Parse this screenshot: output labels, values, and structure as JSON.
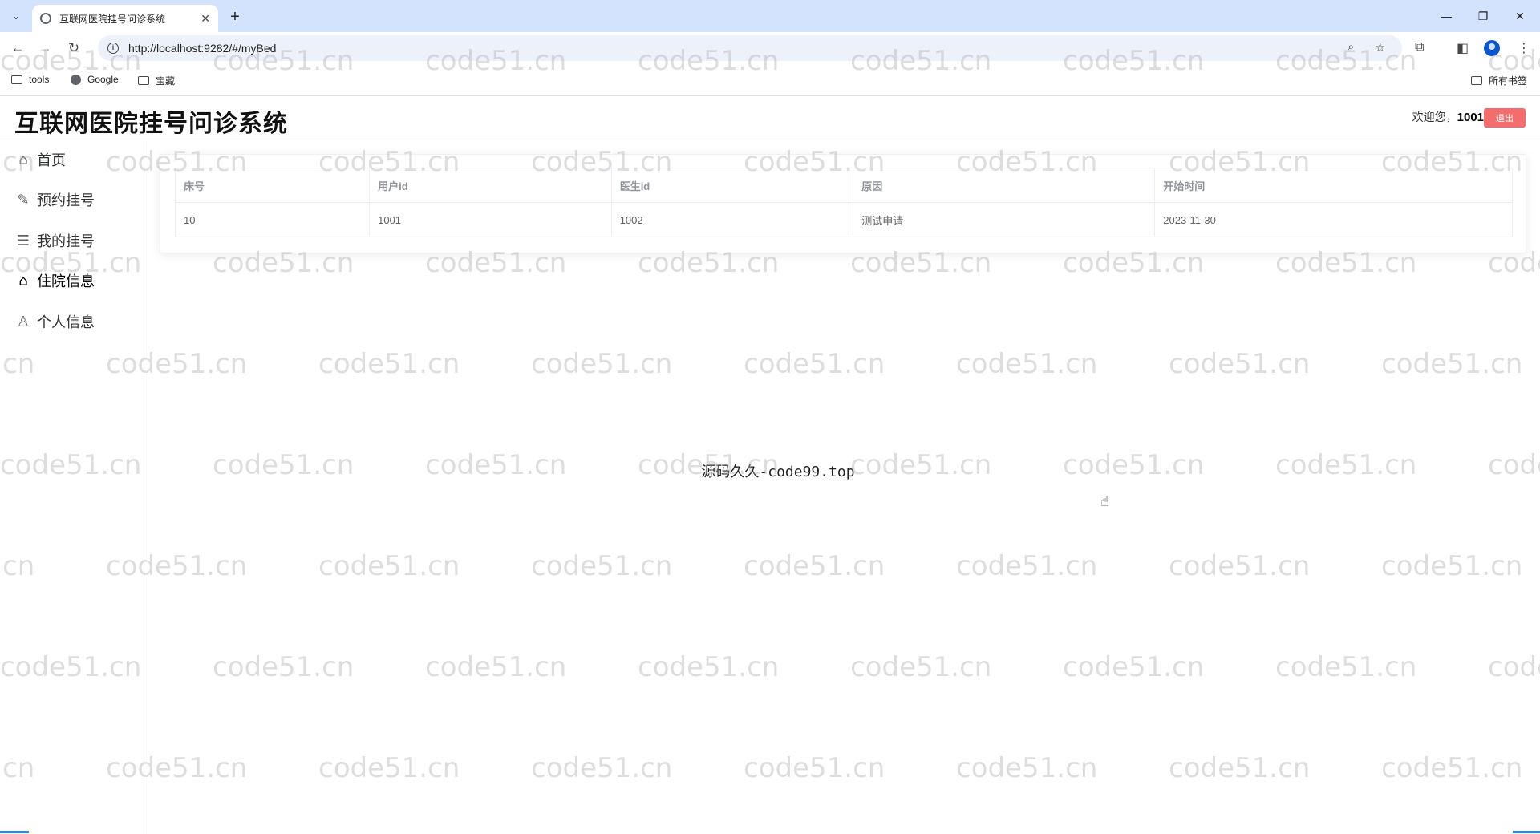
{
  "browser": {
    "tab_title": "互联网医院挂号问诊系统",
    "url": "http://localhost:9282/#/myBed",
    "bookmarks": [
      "tools",
      "Google",
      "宝藏"
    ],
    "all_bookmarks": "所有书签"
  },
  "app": {
    "title": "互联网医院挂号问诊系统",
    "welcome_prefix": "欢迎您，",
    "username": "1001",
    "logout_label": "退出"
  },
  "sidebar": {
    "items": [
      {
        "label": "首页",
        "icon": "home-icon"
      },
      {
        "label": "预约挂号",
        "icon": "edit-icon"
      },
      {
        "label": "我的挂号",
        "icon": "list-icon"
      },
      {
        "label": "住院信息",
        "icon": "home-icon",
        "active": true
      },
      {
        "label": "个人信息",
        "icon": "user-icon"
      }
    ]
  },
  "table": {
    "columns": [
      "床号",
      "用户id",
      "医生id",
      "原因",
      "开始时间"
    ],
    "rows": [
      [
        "10",
        "1001",
        "1002",
        "测试申请",
        "2023-11-30"
      ]
    ]
  },
  "footer_text": "源码久久-code99.top",
  "watermark": "code51.cn"
}
